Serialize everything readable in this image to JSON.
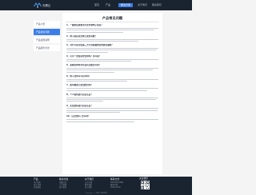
{
  "header": {
    "logo_text": "天赐云",
    "nav": [
      {
        "label": "首页",
        "active": false
      },
      {
        "label": "产品",
        "active": false
      },
      {
        "label": "解决方案",
        "active": true
      },
      {
        "label": "关于我们",
        "active": false
      },
      {
        "label": "联系我们",
        "active": false
      }
    ]
  },
  "sidebar": {
    "items": [
      {
        "label": "产品介绍",
        "active": false
      },
      {
        "label": "产品常见问题",
        "active": true
      },
      {
        "label": "产品使用说明",
        "active": false
      },
      {
        "label": "产品服务条款",
        "active": false
      }
    ]
  },
  "content": {
    "title": "产品常见问题",
    "questions": [
      "1、一般的话是要怎么去申请电子签名？",
      "2、电子签名在法律上是否有效？",
      "3、为什么说可信第三方平台签署的合同更有保障？",
      "4、可以一次签多份合同吗？怎么签？",
      "5、签署合同时对方没有注册怎么办？",
      "6、电子合同可以打印吗？",
      "7、如何修改已发出的合同？",
      "8、个人如何进行实名认证？",
      "9、企业如何进行实名认证？",
      "10、忘记密码了怎么办？"
    ]
  },
  "footer": {
    "columns": [
      {
        "title": "产品",
        "lines": [
          "电子签名",
          "电子合同",
          "存证服务"
        ]
      },
      {
        "title": "解决方案",
        "lines": [
          "金融行业",
          "人力资源",
          "房产租赁"
        ]
      },
      {
        "title": "关于我们",
        "lines": [
          "公司介绍",
          "联系我们",
          "加入我们"
        ]
      },
      {
        "title": "联系方式",
        "lines": [
          "400-000-0000",
          "服务时间",
          "9:00-18:00"
        ]
      }
    ],
    "qr_label": "关注我们",
    "copyright": "Copyright © 天赐云 版权所有"
  },
  "colors": {
    "nav_bg": "#1a2330",
    "accent": "#3c7ee8",
    "page_bg": "#f4f4f4"
  }
}
